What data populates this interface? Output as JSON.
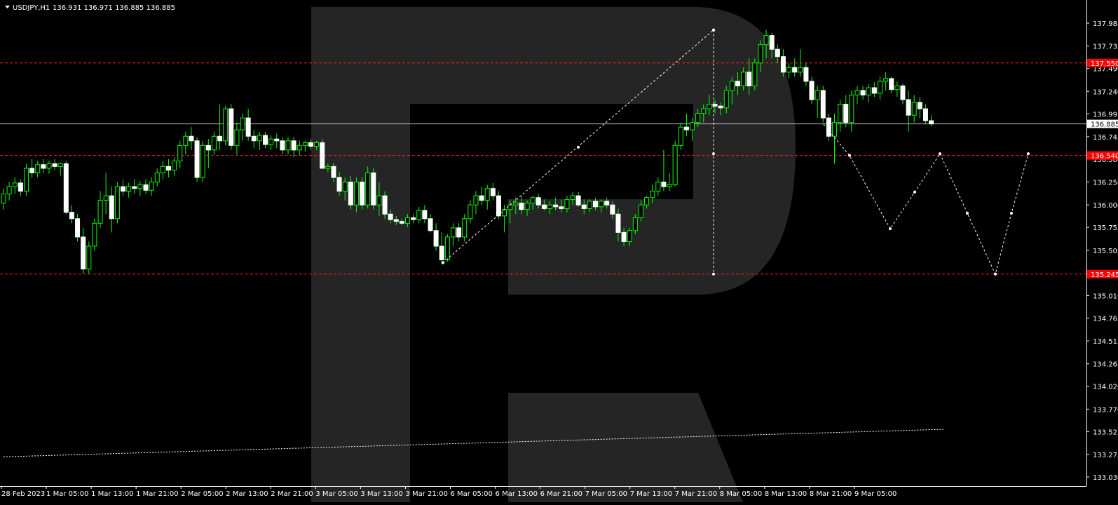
{
  "header": {
    "symbol_label": "USDJPY,H1",
    "ohlc_text": "136.931 136.971 136.885 136.885"
  },
  "chart_data": {
    "type": "candlestick",
    "symbol": "USDJPY",
    "timeframe": "H1",
    "title": "USDJPY,H1",
    "ylim": [
      133.03,
      138.13
    ],
    "y_ticks": [
      137.985,
      137.735,
      137.49,
      137.24,
      136.995,
      136.745,
      136.5,
      136.25,
      136.0,
      135.755,
      135.505,
      135.26,
      135.01,
      134.765,
      134.515,
      134.265,
      134.02,
      133.77,
      133.525,
      133.275,
      133.03
    ],
    "y_tick_labels": [
      "137.985",
      "137.735",
      "137.490",
      "137.240",
      "136.995",
      "136.745",
      "136.500",
      "136.250",
      "136.000",
      "135.755",
      "135.505",
      "135.260",
      "135.010",
      "134.765",
      "134.515",
      "134.265",
      "134.020",
      "133.770",
      "133.525",
      "133.275",
      "133.030"
    ],
    "x_labels": [
      "28 Feb 2023",
      "1 Mar 05:00",
      "1 Mar 13:00",
      "1 Mar 21:00",
      "2 Mar 05:00",
      "2 Mar 13:00",
      "2 Mar 21:00",
      "3 Mar 05:00",
      "3 Mar 13:00",
      "3 Mar 21:00",
      "6 Mar 05:00",
      "6 Mar 13:00",
      "6 Mar 21:00",
      "7 Mar 05:00",
      "7 Mar 13:00",
      "7 Mar 21:00",
      "8 Mar 05:00",
      "8 Mar 13:00",
      "8 Mar 21:00",
      "9 Mar 05:00"
    ],
    "current_price": 136.885,
    "current_price_label": "136.885",
    "levels": [
      {
        "value": 137.55,
        "label": "137.550"
      },
      {
        "value": 136.54,
        "label": "136.540"
      },
      {
        "value": 135.245,
        "label": "135.245"
      }
    ],
    "candles": [
      [
        136.02,
        136.18,
        135.95,
        136.12
      ],
      [
        136.12,
        136.25,
        136.05,
        136.2
      ],
      [
        136.2,
        136.3,
        136.12,
        136.24
      ],
      [
        136.24,
        136.28,
        136.1,
        136.15
      ],
      [
        136.15,
        136.45,
        136.1,
        136.4
      ],
      [
        136.4,
        136.5,
        136.3,
        136.35
      ],
      [
        136.35,
        136.48,
        136.3,
        136.44
      ],
      [
        136.44,
        136.5,
        136.35,
        136.4
      ],
      [
        136.4,
        136.48,
        136.34,
        136.45
      ],
      [
        136.45,
        136.5,
        136.38,
        136.42
      ],
      [
        136.42,
        136.46,
        136.32,
        136.45
      ],
      [
        136.45,
        136.48,
        135.9,
        135.92
      ],
      [
        135.92,
        136.0,
        135.8,
        135.85
      ],
      [
        135.85,
        135.9,
        135.6,
        135.65
      ],
      [
        135.65,
        135.75,
        135.25,
        135.3
      ],
      [
        135.3,
        135.6,
        135.25,
        135.55
      ],
      [
        135.55,
        135.85,
        135.5,
        135.8
      ],
      [
        135.8,
        136.15,
        135.75,
        136.05
      ],
      [
        136.05,
        136.35,
        135.9,
        136.1
      ],
      [
        136.1,
        136.2,
        135.7,
        135.85
      ],
      [
        135.85,
        136.25,
        135.8,
        136.2
      ],
      [
        136.2,
        136.28,
        136.1,
        136.15
      ],
      [
        136.15,
        136.24,
        136.08,
        136.2
      ],
      [
        136.2,
        136.28,
        136.12,
        136.18
      ],
      [
        136.18,
        136.26,
        136.1,
        136.22
      ],
      [
        136.22,
        136.28,
        136.12,
        136.16
      ],
      [
        136.16,
        136.3,
        136.1,
        136.25
      ],
      [
        136.25,
        136.4,
        136.2,
        136.35
      ],
      [
        136.35,
        136.48,
        136.28,
        136.42
      ],
      [
        136.42,
        136.5,
        136.3,
        136.38
      ],
      [
        136.38,
        136.52,
        136.32,
        136.48
      ],
      [
        136.48,
        136.7,
        136.4,
        136.65
      ],
      [
        136.65,
        136.8,
        136.55,
        136.75
      ],
      [
        136.75,
        136.85,
        136.6,
        136.7
      ],
      [
        136.7,
        136.74,
        136.25,
        136.3
      ],
      [
        136.3,
        136.7,
        136.25,
        136.65
      ],
      [
        136.65,
        136.72,
        136.4,
        136.6
      ],
      [
        136.6,
        136.8,
        136.55,
        136.75
      ],
      [
        136.75,
        137.1,
        136.6,
        136.7
      ],
      [
        136.7,
        137.08,
        136.65,
        137.05
      ],
      [
        137.05,
        137.1,
        136.6,
        136.65
      ],
      [
        136.65,
        136.9,
        136.55,
        136.82
      ],
      [
        136.82,
        137.0,
        136.7,
        136.95
      ],
      [
        136.95,
        137.05,
        136.7,
        136.75
      ],
      [
        136.75,
        136.82,
        136.62,
        136.7
      ],
      [
        136.7,
        136.8,
        136.6,
        136.76
      ],
      [
        136.76,
        136.8,
        136.62,
        136.66
      ],
      [
        136.66,
        136.76,
        136.6,
        136.72
      ],
      [
        136.72,
        136.78,
        136.62,
        136.7
      ],
      [
        136.7,
        136.74,
        136.55,
        136.6
      ],
      [
        136.6,
        136.74,
        136.55,
        136.7
      ],
      [
        136.7,
        136.74,
        136.52,
        136.6
      ],
      [
        136.6,
        136.7,
        136.54,
        136.65
      ],
      [
        136.65,
        136.7,
        136.58,
        136.68
      ],
      [
        136.68,
        136.72,
        136.6,
        136.64
      ],
      [
        136.64,
        136.7,
        136.6,
        136.68
      ],
      [
        136.68,
        136.72,
        136.55,
        136.4
      ],
      [
        136.4,
        136.45,
        136.36,
        136.42
      ],
      [
        136.42,
        136.46,
        136.25,
        136.3
      ],
      [
        136.3,
        136.36,
        136.1,
        136.15
      ],
      [
        136.15,
        136.3,
        136.05,
        136.25
      ],
      [
        136.25,
        136.32,
        135.95,
        136.0
      ],
      [
        136.0,
        136.3,
        135.92,
        136.25
      ],
      [
        136.25,
        136.3,
        135.95,
        136.0
      ],
      [
        136.0,
        136.42,
        135.96,
        136.35
      ],
      [
        136.35,
        136.4,
        135.95,
        136.0
      ],
      [
        136.0,
        136.25,
        135.88,
        136.1
      ],
      [
        136.1,
        136.15,
        135.85,
        135.9
      ],
      [
        135.9,
        135.95,
        135.8,
        135.84
      ],
      [
        135.84,
        135.88,
        135.78,
        135.82
      ],
      [
        135.82,
        135.85,
        135.78,
        135.8
      ],
      [
        135.8,
        135.9,
        135.76,
        135.86
      ],
      [
        135.86,
        135.9,
        135.8,
        135.84
      ],
      [
        135.84,
        135.98,
        135.8,
        135.94
      ],
      [
        135.94,
        136.0,
        135.8,
        135.85
      ],
      [
        135.85,
        135.9,
        135.7,
        135.72
      ],
      [
        135.72,
        135.8,
        135.5,
        135.55
      ],
      [
        135.55,
        135.7,
        135.35,
        135.4
      ],
      [
        135.4,
        135.68,
        135.38,
        135.65
      ],
      [
        135.65,
        135.8,
        135.55,
        135.75
      ],
      [
        135.75,
        135.8,
        135.6,
        135.65
      ],
      [
        135.65,
        135.9,
        135.6,
        135.85
      ],
      [
        135.85,
        136.05,
        135.8,
        136.0
      ],
      [
        136.0,
        136.15,
        135.9,
        136.1
      ],
      [
        136.1,
        136.2,
        136.0,
        136.05
      ],
      [
        136.05,
        136.22,
        135.95,
        136.18
      ],
      [
        136.18,
        136.24,
        136.05,
        136.1
      ],
      [
        136.1,
        136.15,
        135.85,
        135.88
      ],
      [
        135.88,
        136.0,
        135.7,
        135.95
      ],
      [
        135.95,
        136.05,
        135.8,
        136.0
      ],
      [
        136.0,
        136.08,
        135.9,
        136.02
      ],
      [
        136.02,
        136.1,
        135.9,
        135.95
      ],
      [
        135.95,
        136.05,
        135.88,
        136.02
      ],
      [
        136.02,
        136.1,
        135.95,
        136.08
      ],
      [
        136.08,
        136.12,
        135.96,
        136.0
      ],
      [
        136.0,
        136.06,
        135.94,
        135.96
      ],
      [
        135.96,
        136.04,
        135.9,
        136.0
      ],
      [
        136.0,
        136.08,
        135.94,
        135.98
      ],
      [
        135.98,
        136.06,
        135.92,
        135.96
      ],
      [
        135.96,
        136.1,
        135.92,
        136.06
      ],
      [
        136.06,
        136.14,
        136.0,
        136.1
      ],
      [
        136.1,
        136.14,
        135.98,
        136.0
      ],
      [
        136.0,
        136.06,
        135.9,
        135.96
      ],
      [
        135.96,
        136.06,
        135.92,
        136.04
      ],
      [
        136.04,
        136.08,
        135.94,
        135.98
      ],
      [
        135.98,
        136.06,
        135.92,
        136.04
      ],
      [
        136.04,
        136.08,
        135.96,
        136.0
      ],
      [
        136.0,
        136.04,
        135.85,
        135.9
      ],
      [
        135.9,
        135.96,
        135.6,
        135.7
      ],
      [
        135.7,
        135.75,
        135.55,
        135.6
      ],
      [
        135.6,
        135.75,
        135.55,
        135.72
      ],
      [
        135.72,
        135.9,
        135.68,
        135.86
      ],
      [
        135.86,
        136.05,
        135.82,
        136.0
      ],
      [
        136.0,
        136.1,
        135.96,
        136.08
      ],
      [
        136.08,
        136.22,
        136.02,
        136.15
      ],
      [
        136.15,
        136.3,
        136.1,
        136.25
      ],
      [
        136.25,
        136.6,
        136.15,
        136.2
      ],
      [
        136.2,
        136.35,
        136.15,
        136.22
      ],
      [
        136.22,
        136.7,
        136.2,
        136.65
      ],
      [
        136.65,
        136.9,
        136.6,
        136.85
      ],
      [
        136.85,
        137.0,
        136.75,
        136.82
      ],
      [
        136.82,
        136.95,
        136.7,
        136.9
      ],
      [
        136.9,
        137.05,
        136.85,
        137.0
      ],
      [
        137.0,
        137.1,
        136.9,
        137.05
      ],
      [
        137.05,
        137.2,
        136.98,
        137.1
      ],
      [
        137.1,
        137.15,
        137.0,
        137.08
      ],
      [
        137.08,
        137.12,
        136.98,
        137.06
      ],
      [
        137.06,
        137.3,
        137.0,
        137.25
      ],
      [
        137.25,
        137.4,
        137.1,
        137.35
      ],
      [
        137.35,
        137.45,
        137.2,
        137.3
      ],
      [
        137.3,
        137.5,
        137.25,
        137.45
      ],
      [
        137.45,
        137.6,
        137.2,
        137.3
      ],
      [
        137.3,
        137.6,
        137.25,
        137.55
      ],
      [
        137.55,
        137.8,
        137.45,
        137.75
      ],
      [
        137.75,
        137.91,
        137.6,
        137.85
      ],
      [
        137.85,
        137.88,
        137.6,
        137.7
      ],
      [
        137.7,
        137.75,
        137.55,
        137.62
      ],
      [
        137.62,
        137.7,
        137.4,
        137.45
      ],
      [
        137.45,
        137.55,
        137.38,
        137.5
      ],
      [
        137.5,
        137.6,
        137.4,
        137.45
      ],
      [
        137.45,
        137.7,
        137.4,
        137.5
      ],
      [
        137.5,
        137.55,
        137.3,
        137.35
      ],
      [
        137.35,
        137.4,
        137.1,
        137.15
      ],
      [
        137.15,
        137.3,
        136.95,
        137.25
      ],
      [
        137.25,
        137.3,
        136.9,
        136.95
      ],
      [
        136.95,
        137.0,
        136.7,
        136.75
      ],
      [
        136.75,
        137.0,
        136.45,
        136.9
      ],
      [
        136.9,
        137.15,
        136.8,
        137.1
      ],
      [
        137.1,
        137.2,
        136.85,
        136.9
      ],
      [
        136.9,
        137.25,
        136.8,
        137.2
      ],
      [
        137.2,
        137.3,
        137.1,
        137.25
      ],
      [
        137.25,
        137.3,
        137.15,
        137.2
      ],
      [
        137.2,
        137.32,
        137.12,
        137.28
      ],
      [
        137.28,
        137.34,
        137.18,
        137.22
      ],
      [
        137.22,
        137.4,
        137.15,
        137.35
      ],
      [
        137.35,
        137.45,
        137.25,
        137.38
      ],
      [
        137.38,
        137.4,
        137.22,
        137.26
      ],
      [
        137.26,
        137.35,
        137.18,
        137.3
      ],
      [
        137.3,
        137.32,
        137.1,
        137.15
      ],
      [
        137.15,
        137.25,
        136.8,
        136.98
      ],
      [
        136.98,
        137.2,
        136.9,
        137.12
      ],
      [
        137.12,
        137.18,
        136.95,
        137.05
      ],
      [
        137.05,
        137.1,
        136.88,
        136.92
      ],
      [
        136.92,
        136.98,
        136.86,
        136.885
      ]
    ],
    "annotations": {
      "impulse_line": [
        [
          136.0,
          135.37
        ],
        [
          1018,
          137.91
        ]
      ],
      "vertical_line": [
        137.91,
        135.25
      ],
      "forecast_path": [
        136.88,
        136.54,
        135.74,
        136.14,
        136.56,
        135.91,
        135.245,
        135.91,
        136.56
      ],
      "trend_line": [
        133.25,
        133.55
      ]
    },
    "colors": {
      "background": "#000000",
      "bull_candle": "#000000",
      "bull_outline": "#00ff00",
      "bear_candle": "#ffffff",
      "level_line": "#ff2020",
      "level_tag": "#ff0000",
      "current_line": "#c0c0c0",
      "watermark": "#252525"
    }
  }
}
